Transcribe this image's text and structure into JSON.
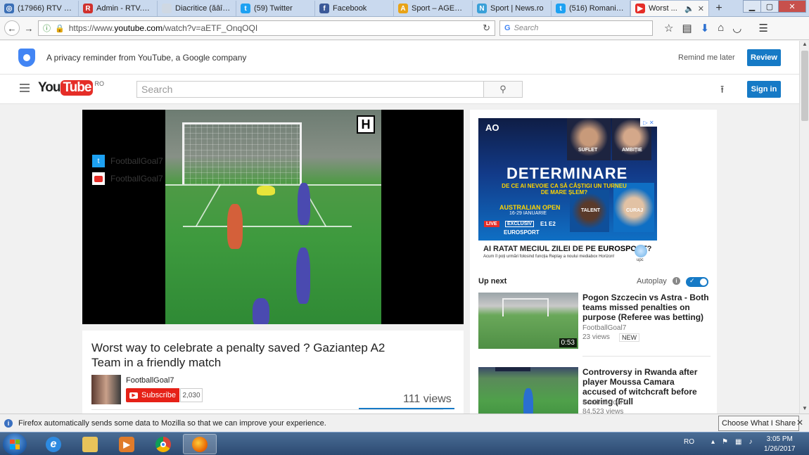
{
  "tabs": [
    {
      "label": "(17966) RTV W...",
      "icon": "globe-icon",
      "color": "#3b6fb6",
      "glyph": "◎"
    },
    {
      "label": "Admin - RTV.n...",
      "icon": "rtv-icon",
      "color": "#d0312d",
      "glyph": "R"
    },
    {
      "label": "Diacritice (ăâîşţ) - t...",
      "icon": "blank-page-icon",
      "color": "#cfd8e3",
      "glyph": ""
    },
    {
      "label": "(59) Twitter",
      "icon": "twitter-icon",
      "color": "#1da1f2",
      "glyph": "t"
    },
    {
      "label": "Facebook",
      "icon": "facebook-icon",
      "color": "#3b5998",
      "glyph": "f"
    },
    {
      "label": "Sport – AGERP...",
      "icon": "agerpres-icon",
      "color": "#e8a317",
      "glyph": "A"
    },
    {
      "label": "Sport | News.ro",
      "icon": "newsro-icon",
      "color": "#3aa0d8",
      "glyph": "N"
    },
    {
      "label": "(516) Romania ...",
      "icon": "twitter-icon",
      "color": "#1da1f2",
      "glyph": "t"
    },
    {
      "label": "Worst ...",
      "icon": "youtube-icon",
      "color": "#e52d27",
      "glyph": "▶",
      "active": true
    }
  ],
  "browser": {
    "url_prefix": "https://www.",
    "url_domain": "youtube.com",
    "url_path": "/watch?v=aETF_OnqOQI",
    "search_placeholder": "Search",
    "new_tab": "+",
    "reload": "↻"
  },
  "privacy": {
    "text": "A privacy reminder from YouTube, a Google company",
    "remind_label": "Remind me later",
    "review_label": "Review"
  },
  "masthead": {
    "logo_you": "You",
    "logo_tube": "Tube",
    "logo_region": "RO",
    "search_placeholder": "Search",
    "signin_label": "Sign in"
  },
  "player": {
    "watermark": "H",
    "social_twitter": "FootballGoal7",
    "social_youtube": "FootballGoal7"
  },
  "video": {
    "title": "Worst way to celebrate a penalty saved ? Gaziantep A2 Team in a friendly match",
    "channel": "FootballGoal7",
    "subscribe_label": "Subscribe",
    "subscriber_count": "2,030",
    "views": "111 views"
  },
  "ad": {
    "brand": "AO",
    "headline": "DETERMINARE",
    "question": "DE CE AI NEVOIE CA SĂ CÂȘTIGI UN TURNEU DE MARE ȘLEM?",
    "event": "AUSTRALIAN OPEN",
    "dates": "16-29 IANUARIE",
    "live": "LIVE",
    "exclusive": "EXCLUSIV",
    "channels": "E1 E2",
    "network": "EUROSPORT",
    "tags": [
      "SUFLET",
      "AMBIȚIE",
      "TALENT",
      "CURAJ"
    ],
    "caption_prefix": "AI RATAT MECIUL ZILEI DE PE ",
    "caption_brand": "EUROSPORT",
    "caption_brand_suffix": "?",
    "subcaption": "Acum îl poți urmări folosind funcția Replay a noului mediabox Horizon!",
    "sponsor": "upc"
  },
  "sidebar": {
    "up_next": "Up next",
    "autoplay": "Autoplay",
    "videos": [
      {
        "title": "Pogon Szczecin vs Astra - Both teams missed penalties on purpose (Referee was betting)",
        "channel": "FootballGoal7",
        "views": "23 views",
        "badge": "NEW",
        "duration": "0:53"
      },
      {
        "title": "Controversy in Rwanda after player Moussa Camara accused of witchcraft before scoring (Full",
        "channel": "FootballGoal7",
        "views": "84,523 views"
      }
    ]
  },
  "notification": {
    "text": "Firefox automatically sends some data to Mozilla so that we can improve your experience.",
    "choose_label": "Choose What I Share"
  },
  "taskbar": {
    "language": "RO",
    "time": "3:05 PM",
    "date": "1/26/2017"
  },
  "colors": {
    "youtube_red": "#e52d27",
    "youtube_blue": "#167ac6"
  }
}
